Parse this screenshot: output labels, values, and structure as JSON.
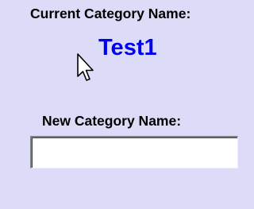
{
  "form": {
    "current_label": "Current Category Name:",
    "current_value": "Test1",
    "new_label": "New Category Name:",
    "new_value": ""
  },
  "colors": {
    "background": "#dcdcf8",
    "value_text": "#0000f0",
    "label_text": "#000000"
  },
  "icons": {
    "cursor": "mouse-pointer-arrow"
  }
}
